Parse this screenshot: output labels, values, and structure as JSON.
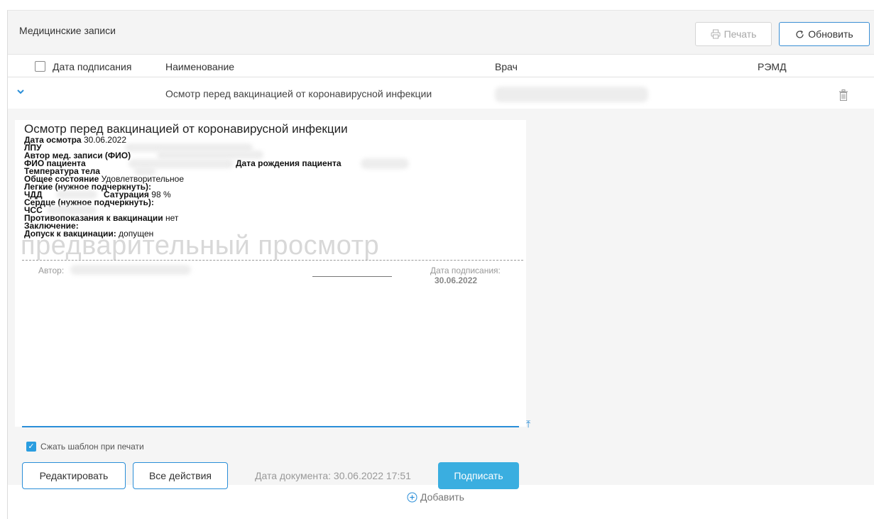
{
  "header": {
    "title": "Медицинские записи",
    "print_label": "Печать",
    "refresh_label": "Обновить"
  },
  "columns": {
    "date": "Дата подписания",
    "name": "Наименование",
    "doctor": "Врач",
    "remd": "РЭМД"
  },
  "record": {
    "title": "Осмотр перед вакцинацией от коронавирусной инфекции"
  },
  "document": {
    "title": "Осмотр перед вакцинацией от коронавирусной инфекции",
    "exam_date_label": "Дата осмотра",
    "exam_date_value": "30.06.2022",
    "lpu_label": "ЛПУ",
    "author_label": "Автор мед. записи (ФИО)",
    "patient_label": "ФИО пациента",
    "birth_label": "Дата рождения пациента",
    "temp_label": "Температура тела",
    "general_label": "Общее состояние",
    "general_value": "Удовлетворительное",
    "lungs_label": "Легкие (нужное подчеркнуть):",
    "chdd_label": "ЧДД",
    "sat_label": "Сатурация",
    "sat_value": "98 %",
    "heart_label": "Сердце (нужное подчеркнуть):",
    "chss_label": "ЧСС",
    "contra_label": "Противопоказания к вакцинации",
    "contra_value": "нет",
    "conclusion_label": "Заключение:",
    "admission_label": "Допуск к вакцинации:",
    "admission_value": "допущен",
    "watermark": "предварительный просмотр",
    "author_footer": "Автор:",
    "sign_label": "Дата подписания:",
    "sign_date": "30.06.2022"
  },
  "actions": {
    "compress_label": "Сжать шаблон при печати",
    "edit_label": "Редактировать",
    "all_actions_label": "Все действия",
    "doc_date": "Дата документа: 30.06.2022 17:51",
    "sign_label": "Подписать"
  },
  "add_label": "Добавить",
  "colors": {
    "accent": "#2a8ed8",
    "sign_button": "#3aaee0",
    "checkbox": "#2a9de0"
  }
}
